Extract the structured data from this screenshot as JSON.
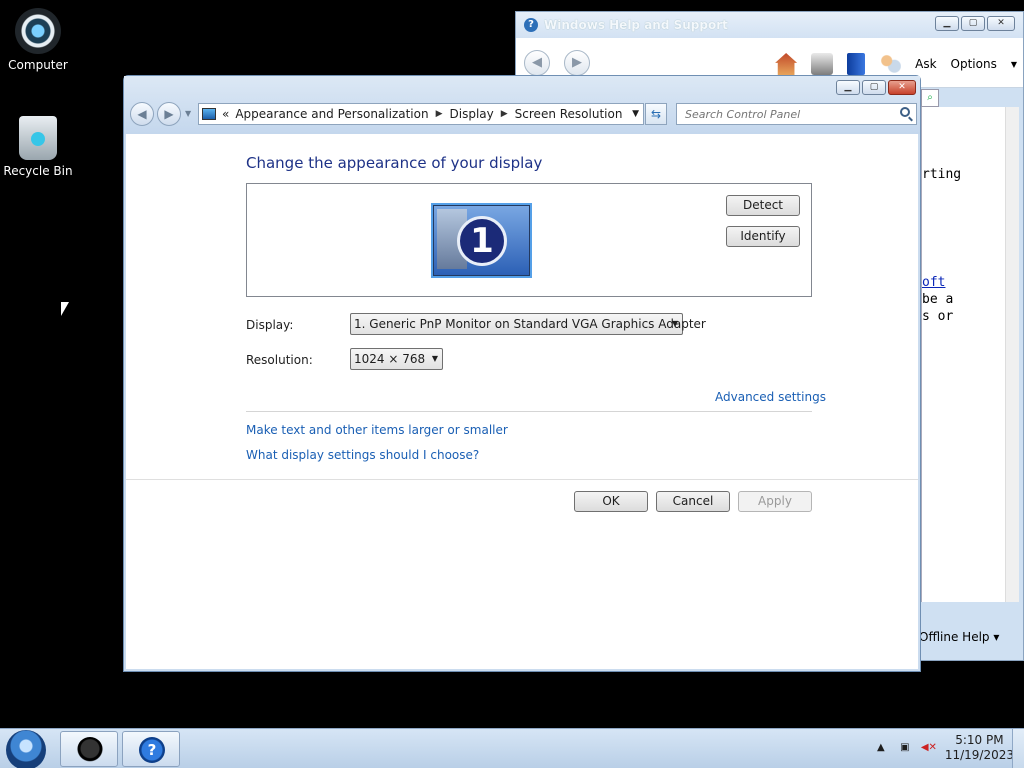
{
  "desktop": {
    "icons": [
      {
        "label": "Computer"
      },
      {
        "label": "Recycle Bin"
      }
    ]
  },
  "help_window": {
    "title": "Windows Help and Support",
    "ask_label": "Ask",
    "options_label": "Options",
    "body_lines": [
      "rting",
      "oft",
      "be a",
      "s or"
    ],
    "footer": "Offline Help"
  },
  "main_window": {
    "breadcrumb": [
      "Appearance and Personalization",
      "Display",
      "Screen Resolution"
    ],
    "search_placeholder": "Search Control Panel",
    "heading": "Change the appearance of your display",
    "monitor_number": "1",
    "detect_label": "Detect",
    "identify_label": "Identify",
    "display_label": "Display:",
    "display_value": "1. Generic PnP Monitor on Standard VGA Graphics Adapter",
    "resolution_label": "Resolution:",
    "resolution_value": "1024 × 768",
    "advanced_link": "Advanced settings",
    "link_text_size": "Make text and other items larger or smaller",
    "link_help": "What display settings should I choose?",
    "ok_label": "OK",
    "cancel_label": "Cancel",
    "apply_label": "Apply"
  },
  "taskbar": {
    "time": "5:10 PM",
    "date": "11/19/2023"
  }
}
